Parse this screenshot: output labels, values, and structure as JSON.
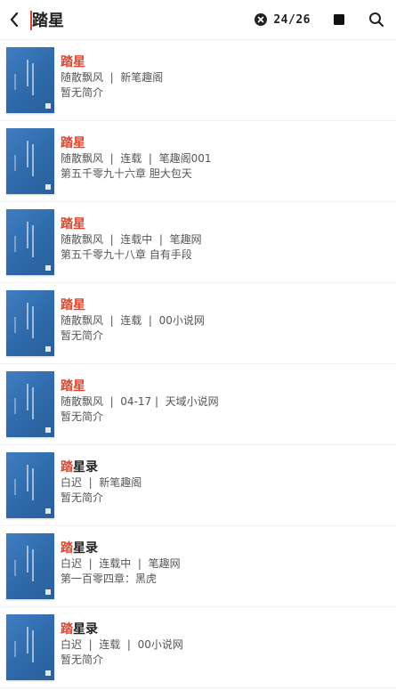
{
  "topbar": {
    "query": "踏星",
    "counter": "24/26",
    "icons": {
      "back": "back-arrow-icon",
      "clear": "clear-circle-icon",
      "stop": "stop-square-icon",
      "search": "search-icon"
    }
  },
  "results": [
    {
      "title_highlight": "踏星",
      "title_rest": "",
      "meta": "随散飘风  |  新笔趣阁",
      "desc": "暂无简介"
    },
    {
      "title_highlight": "踏星",
      "title_rest": "",
      "meta": "随散飘风  |  连载  |  笔趣阁001",
      "desc": "第五千零九十六章 胆大包天"
    },
    {
      "title_highlight": "踏星",
      "title_rest": "",
      "meta": "随散飘风  |  连载中  |  笔趣网",
      "desc": "第五千零九十八章 自有手段"
    },
    {
      "title_highlight": "踏星",
      "title_rest": "",
      "meta": "随散飘风  |  连载  |  00小说网",
      "desc": "暂无简介"
    },
    {
      "title_highlight": "踏星",
      "title_rest": "",
      "meta": "随散飘风  |  04-17 |  天域小说网",
      "desc": "暂无简介"
    },
    {
      "title_highlight": "踏",
      "title_rest": "星录",
      "meta": "白迟  |  新笔趣阁",
      "desc": "暂无简介"
    },
    {
      "title_highlight": "踏",
      "title_rest": "星录",
      "meta": "白迟  |  连载中  |  笔趣网",
      "desc": "第一百零四章：黑虎"
    },
    {
      "title_highlight": "踏",
      "title_rest": "星录",
      "meta": "白迟  |  连载  |  00小说网",
      "desc": "暂无简介"
    }
  ],
  "colors": {
    "highlight": "#e0462f",
    "cover": "#3a78bd"
  }
}
